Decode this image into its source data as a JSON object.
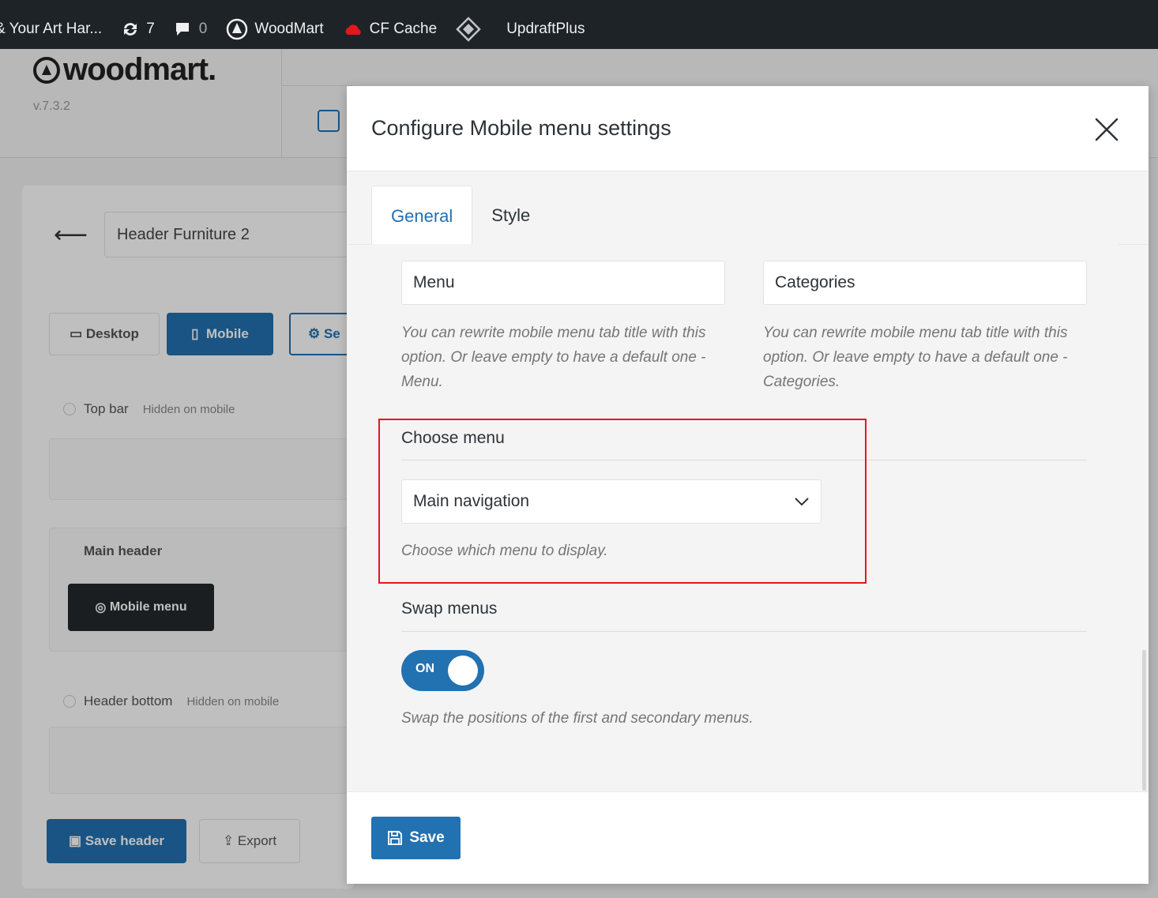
{
  "adminbar": {
    "site_name": "& Your Art Har...",
    "updates_count": "7",
    "comments_count": "0",
    "woodmart_label": "WoodMart",
    "cfcache_label": "CF Cache",
    "updraft_label": "UpdraftPlus"
  },
  "background": {
    "logo": "woodmart.",
    "version": "v.7.3.2",
    "header_name": "Header Furniture 2",
    "desktop_label": "Desktop",
    "mobile_label": "Mobile",
    "settings_label": "Se",
    "top_bar_label": "Top bar",
    "hidden_on_mobile": "Hidden on mobile",
    "main_header_label": "Main header",
    "mobile_menu_label": "Mobile menu",
    "header_bottom_label": "Header bottom",
    "save_header_label": "Save header",
    "export_label": "Export"
  },
  "modal": {
    "title": "Configure Mobile menu settings",
    "tabs": [
      {
        "label": "General",
        "active": true
      },
      {
        "label": "Style",
        "active": false
      }
    ],
    "menu_tab_title": {
      "value": "Menu",
      "description": "You can rewrite mobile menu tab title with this option. Or leave empty to have a default one - Menu."
    },
    "categories_tab_title": {
      "value": "Categories",
      "description": "You can rewrite mobile menu tab title with this option. Or leave empty to have a default one - Categories."
    },
    "choose_menu": {
      "title": "Choose menu",
      "selected": "Main navigation",
      "description": "Choose which menu to display."
    },
    "swap_menus": {
      "title": "Swap menus",
      "toggle_label": "ON",
      "description": "Swap the positions of the first and secondary menus."
    },
    "save_label": "Save"
  },
  "colors": {
    "accent": "#2271b1",
    "highlight": "#e4161c",
    "adminbar": "#1d2327"
  }
}
